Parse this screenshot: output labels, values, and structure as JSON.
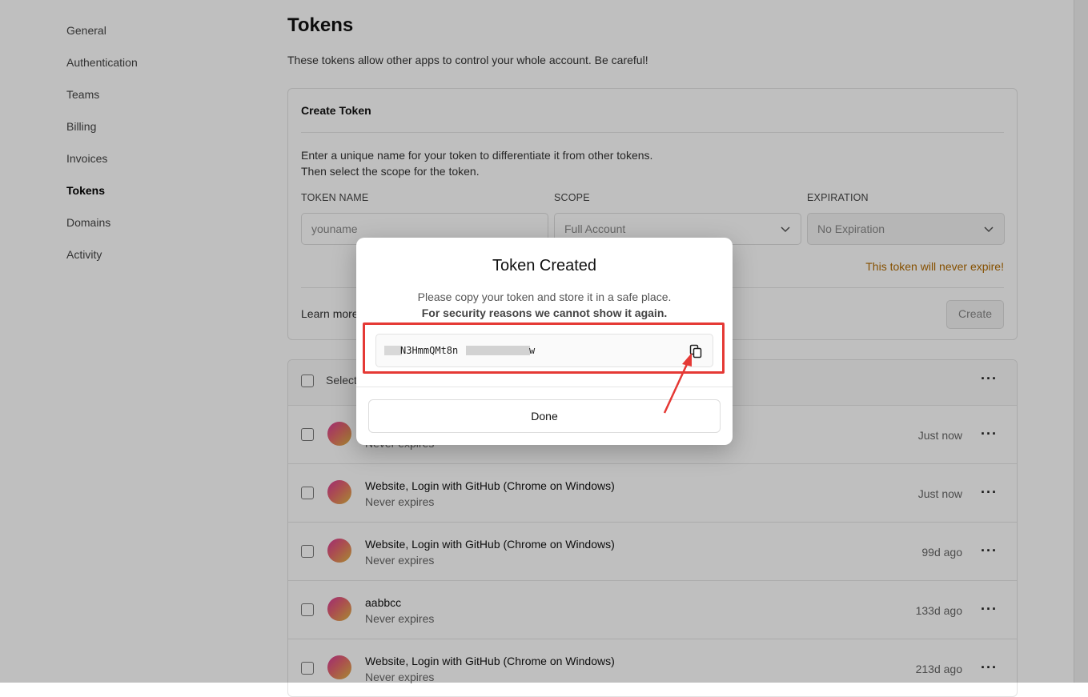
{
  "sidebar": {
    "items": [
      {
        "label": "General"
      },
      {
        "label": "Authentication"
      },
      {
        "label": "Teams"
      },
      {
        "label": "Billing"
      },
      {
        "label": "Invoices"
      },
      {
        "label": "Tokens",
        "active": true
      },
      {
        "label": "Domains"
      },
      {
        "label": "Activity"
      }
    ]
  },
  "page": {
    "title": "Tokens",
    "description": "These tokens allow other apps to control your whole account. Be careful!"
  },
  "create": {
    "title": "Create Token",
    "desc_line1": "Enter a unique name for your token to differentiate it from other tokens.",
    "desc_line2": "Then select the scope for the token.",
    "name_label": "TOKEN NAME",
    "name_placeholder": "youname",
    "scope_label": "SCOPE",
    "scope_value": "Full Account",
    "expiration_label": "EXPIRATION",
    "expiration_value": "No Expiration",
    "warning": "This token will never expire!",
    "learn_more": "Learn more",
    "create_button": "Create"
  },
  "list": {
    "select_label": "Select",
    "rows": [
      {
        "title": "",
        "subtitle": "Never expires",
        "time": "Just now"
      },
      {
        "title": "Website, Login with GitHub (Chrome on Windows)",
        "subtitle": "Never expires",
        "time": "Just now"
      },
      {
        "title": "Website, Login with GitHub (Chrome on Windows)",
        "subtitle": "Never expires",
        "time": "99d ago"
      },
      {
        "title": "aabbcc",
        "subtitle": "Never expires",
        "time": "133d ago"
      },
      {
        "title": "Website, Login with GitHub (Chrome on Windows)",
        "subtitle": "Never expires",
        "time": "213d ago"
      }
    ]
  },
  "modal": {
    "title": "Token Created",
    "line1": "Please copy your token and store it in a safe place.",
    "line2": "For security reasons we cannot show it again.",
    "token_visible": "N3HmmQMt8n",
    "token_end": "w",
    "done_button": "Done"
  },
  "colors": {
    "highlight": "#e53935",
    "warning": "#b36b00",
    "overlay": "rgba(0,0,0,0.25)"
  }
}
